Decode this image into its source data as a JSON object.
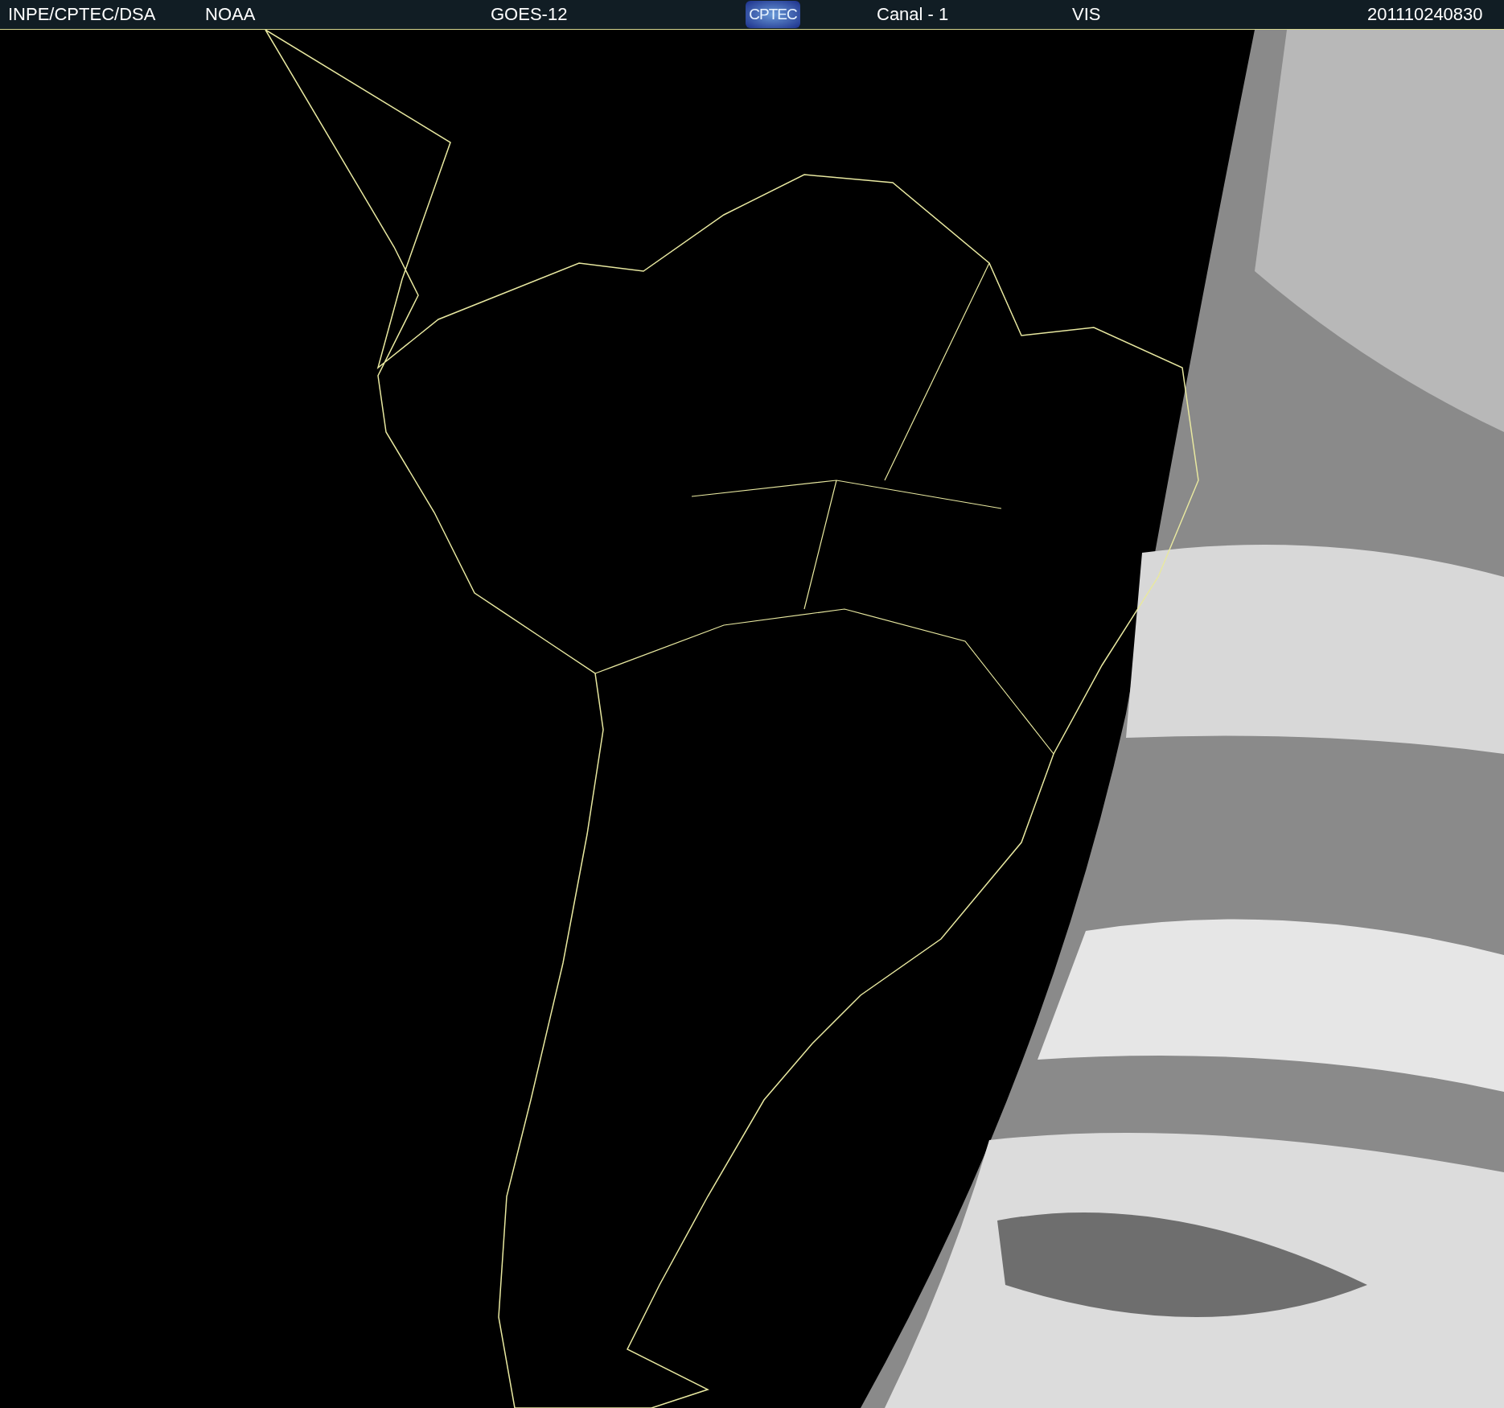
{
  "header": {
    "source": "INPE/CPTEC/DSA",
    "agency": "NOAA",
    "satellite": "GOES-12",
    "logo": "CPTEC",
    "channel": "Canal - 1",
    "band": "VIS",
    "timestamp": "201110240830"
  }
}
